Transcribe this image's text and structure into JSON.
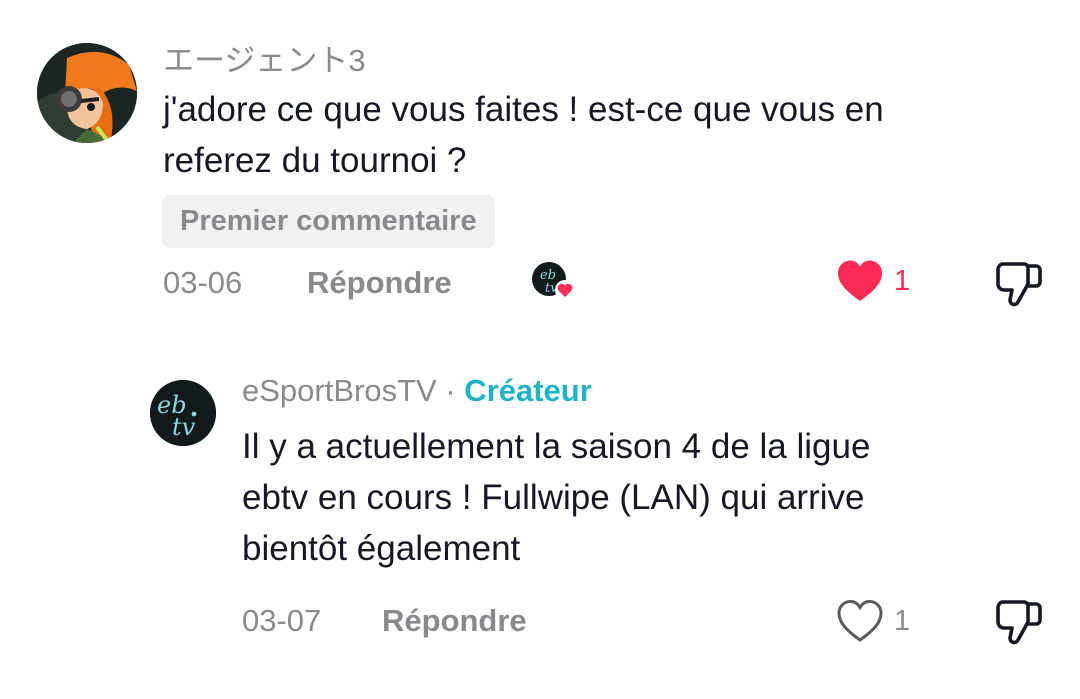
{
  "colors": {
    "muted_text": "#8a8a8e",
    "body_text": "#161823",
    "like_active": "#fe2c55",
    "creator_accent": "#20b3c4",
    "badge_bg": "#f1f1f2"
  },
  "comments": [
    {
      "username": "エージェント3",
      "text_lines": [
        "j'adore ce que vous faites ! est-ce que vous en",
        "referez du tournoi ?"
      ],
      "badge": "Premier commentaire",
      "date": "03-06",
      "reply_label": "Répondre",
      "liked_by_creator": true,
      "liked": true,
      "like_count": "1",
      "like_icon": "heart-filled-icon",
      "dislike_icon": "thumbs-down-icon"
    },
    {
      "username": "eSportBrosTV",
      "separator": "·",
      "creator_label": "Créateur",
      "text_lines": [
        "Il y a actuellement la saison 4 de la ligue",
        "ebtv en cours ! Fullwipe (LAN) qui arrive",
        "bientôt également"
      ],
      "date": "03-07",
      "reply_label": "Répondre",
      "liked": false,
      "like_count": "1",
      "like_icon": "heart-outline-icon",
      "dislike_icon": "thumbs-down-icon"
    }
  ]
}
